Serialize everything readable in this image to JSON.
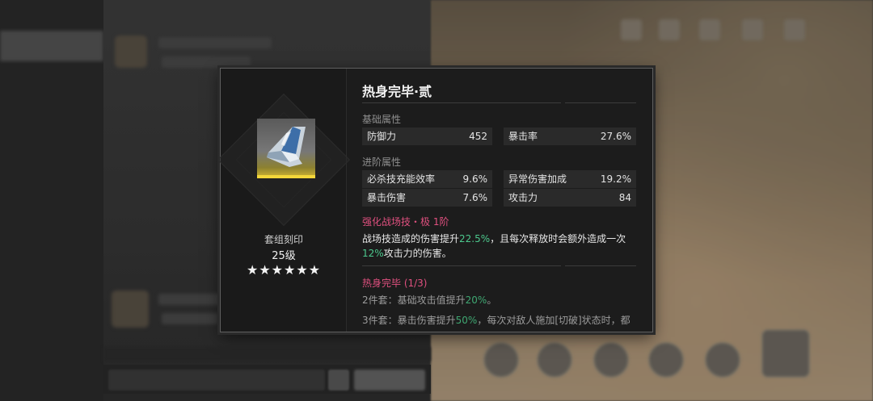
{
  "background": {
    "nav_items": [
      "",
      "",
      ""
    ],
    "bottom_hint": "",
    "send_label": ""
  },
  "popup": {
    "title": "热身完毕·贰",
    "set_label": "套组刻印",
    "level": "25级",
    "stars": "★★★★★★",
    "base_section": "基础属性",
    "base_stats": [
      {
        "name": "防御力",
        "value": "452"
      },
      {
        "name": "暴击率",
        "value": "27.6%"
      }
    ],
    "adv_section": "进阶属性",
    "adv_stats": [
      {
        "name": "必杀技充能效率",
        "value": "9.6%"
      },
      {
        "name": "异常伤害加成",
        "value": "19.2%"
      },
      {
        "name": "暴击伤害",
        "value": "7.6%"
      },
      {
        "name": "攻击力",
        "value": "84"
      }
    ],
    "skill": {
      "title": "强化战场技・极 1阶",
      "desc_a": "战场技造成的伤害提升",
      "desc_b": "22.5%",
      "desc_c": "，且每次释放时会额外造成一次",
      "desc_d": "12%",
      "desc_e": "攻击力的伤害。"
    },
    "set_bonus": {
      "title": "热身完毕 (1/3)",
      "line2_a": "2件套：基础攻击值提升",
      "line2_b": "20%",
      "line2_c": "。",
      "line3_a": "3件套：暴击伤害提升",
      "line3_b": "50%",
      "line3_c": "，每次对敌人施加[切破]状态时，都"
    }
  },
  "colors": {
    "accent_pink": "#e0507f",
    "accent_green": "#4cc88d",
    "rarity_gold": "#f3d63a"
  }
}
